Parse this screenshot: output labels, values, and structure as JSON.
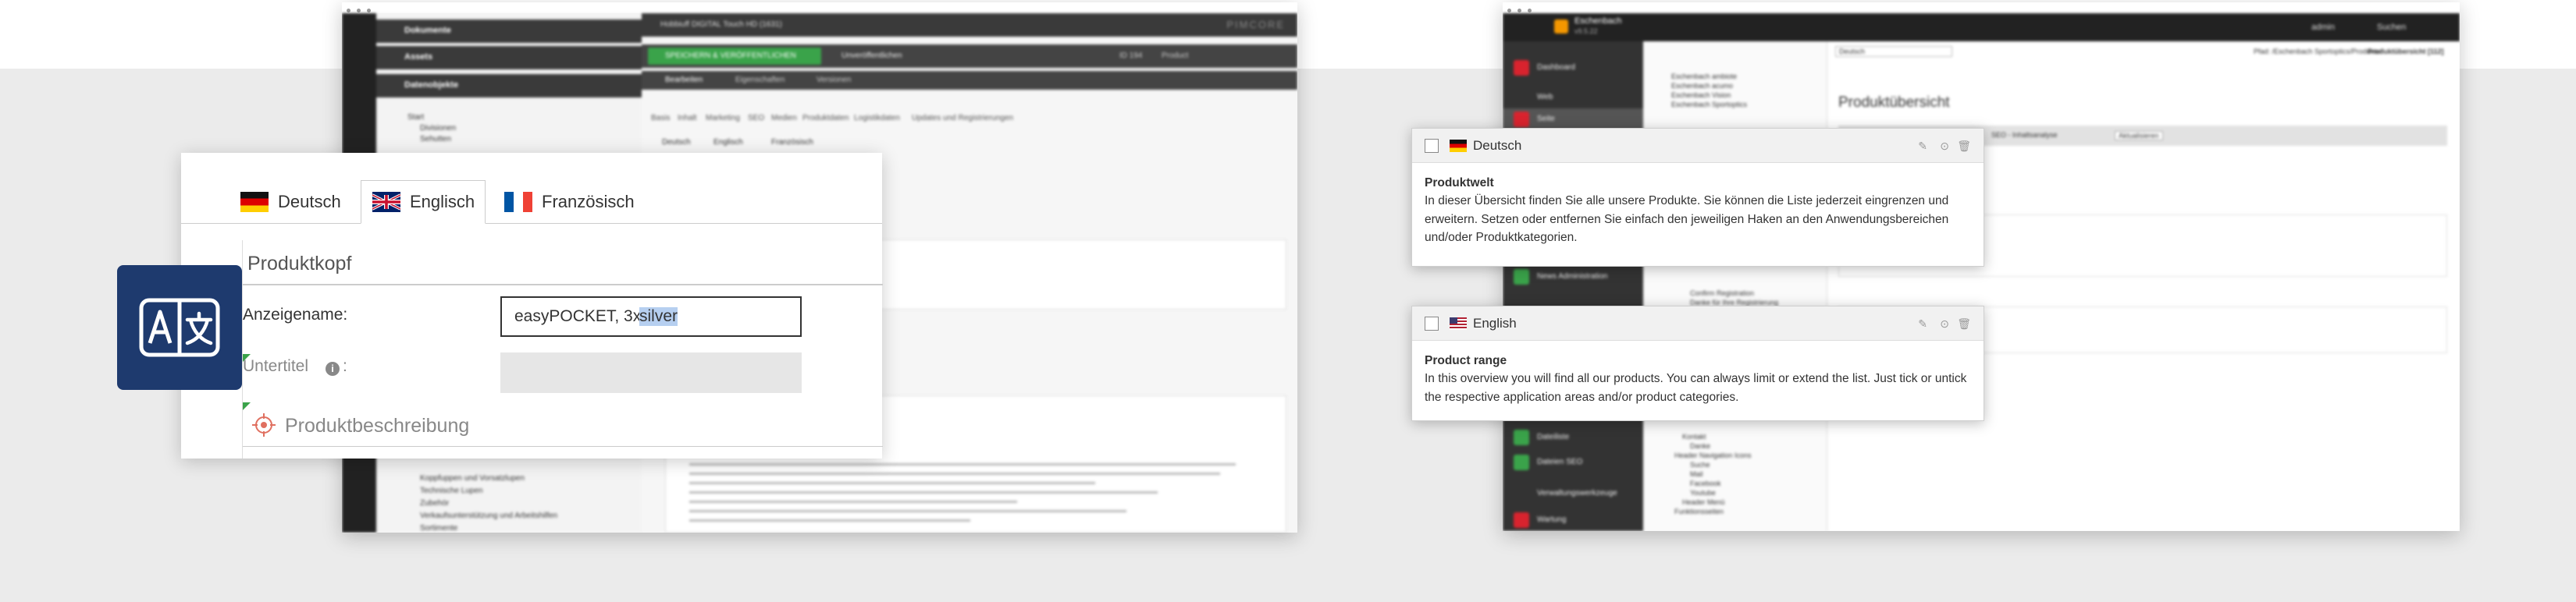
{
  "left_panel": {
    "tabs": [
      {
        "label": "Deutsch",
        "flag": "de"
      },
      {
        "label": "Englisch",
        "flag": "gb"
      },
      {
        "label": "Französisch",
        "flag": "fr"
      }
    ],
    "section_title": "Produktkopf",
    "display_name_label": "Anzeigename:",
    "display_name_value": "easyPOCKET, 3x ",
    "display_name_selected": "silver",
    "subtitle_label": "Untertitel",
    "subtitle_colon": ":",
    "description_title": "Produktbeschreibung",
    "badge_icon": "translate-icon"
  },
  "pimcore_bg": {
    "sidebar_items": [
      "Dokumente",
      "Assets",
      "Datenobjekte"
    ],
    "tree_items": [
      "Start",
      "Divisionen",
      "Sehutten"
    ],
    "tab_title": "Hobbiuff DIGITAL Touch HD (1631)",
    "logo": "PIMCORE",
    "save_button": "SPEICHERN & VERÖFFENTLICHEN",
    "unpublish_button": "Unveröffentlichen",
    "id_text": "ID 194",
    "type_text": "Product",
    "subtabs": [
      "Bearbeiten",
      "Eigenschaften",
      "Versionen"
    ],
    "content_tabs": [
      "Basis",
      "Inhalt",
      "Marketing",
      "SEO",
      "Medien",
      "Produktdaten",
      "Logistikdaten",
      "Updates und Registrierungen"
    ],
    "lang_tabs": [
      "Deutsch",
      "Englisch",
      "Französisch"
    ],
    "bottom_tree": [
      "Koppfuppen und Vorsatzlupen",
      "Technische Lupen",
      "Zubehör",
      "Verkaufsunterstützung und Arbeitshilfen",
      "Sortimente"
    ]
  },
  "typo3_bg": {
    "brand": "Eschenbach",
    "brand_sub": "v9.5.22",
    "user": "admin",
    "search": "Suchen",
    "modules": [
      "Dashboard",
      "Web",
      "Seite"
    ],
    "tree_items": [
      "Eschenbach ambiote",
      "Eschenbach acumo",
      "Eschenbach Vision",
      "Eschenbach Sportoptics"
    ],
    "lang_select": "Deutsch",
    "path": "Pfad: /Eschenbach Sportoptics/Produkte/",
    "page_title_crumb": "Produktübersicht [112]",
    "heading": "Produktübersicht",
    "seo_label": "SEO - Inhaltsanalyse",
    "refresh_label": "Aktualisieren",
    "lower_modules": [
      "News Administration",
      "Dateiliste",
      "Dateien SEO",
      "Verwaltungswerkzeuge",
      "Wartung"
    ],
    "lower_tree": [
      "Confirm Registration",
      "Danke für Ihre Registrierung",
      "Kontakt",
      "Danke",
      "Header Navigation Icons",
      "Suche",
      "Mail",
      "Facebook",
      "Youtube",
      "Header Menü",
      "Funktionsseiten"
    ]
  },
  "popups": [
    {
      "language": "Deutsch",
      "flag": "de",
      "title": "Produktwelt",
      "body": "In dieser Übersicht finden Sie alle unsere Produkte. Sie können die Liste jederzeit eingrenzen und erweitern. Setzen oder entfernen Sie einfach den jeweiligen Haken an den Anwendungsbereichen und/oder Produktkategorien."
    },
    {
      "language": "English",
      "flag": "us",
      "title": "Product range",
      "body": "In this overview you will find all our products. You can always limit or extend the list. Just tick or untick the respective application areas and/or product categories."
    }
  ],
  "colors": {
    "accent_dark_blue": "#1e3a6e",
    "pimcore_green": "#3aa34a",
    "typo3_red": "#d9232e"
  }
}
